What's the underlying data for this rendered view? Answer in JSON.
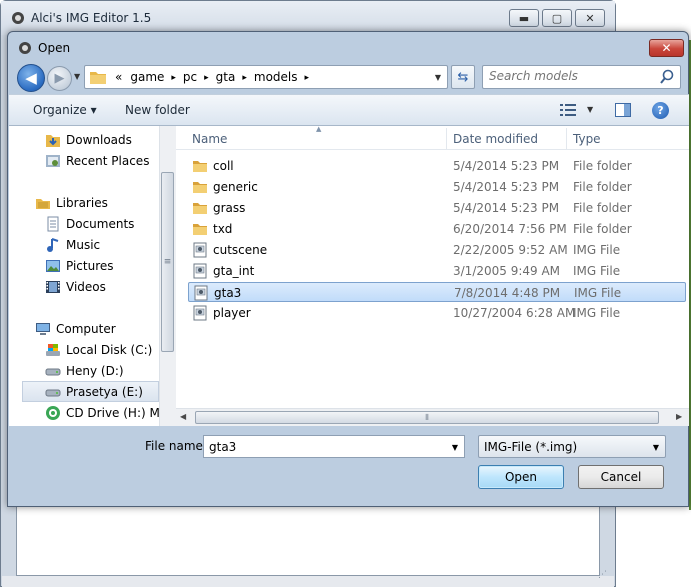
{
  "parent_window": {
    "title": "Alci's IMG Editor 1.5",
    "buttons": {
      "minimize": "▬",
      "maximize": "▢",
      "close": "✕"
    }
  },
  "dialog": {
    "title": "Open",
    "close": "✕"
  },
  "address": {
    "prefix": "«",
    "crumbs": [
      "game",
      "pc",
      "gta",
      "models"
    ],
    "crumb_sep": "▸"
  },
  "search": {
    "placeholder": "Search models"
  },
  "toolbar": {
    "organize": "Organize ▾",
    "new_folder": "New folder",
    "help": "?"
  },
  "nav": {
    "favorites": [
      {
        "label": "Downloads"
      },
      {
        "label": "Recent Places"
      }
    ],
    "libraries_label": "Libraries",
    "libraries": [
      {
        "label": "Documents"
      },
      {
        "label": "Music"
      },
      {
        "label": "Pictures"
      },
      {
        "label": "Videos"
      }
    ],
    "computer_label": "Computer",
    "drives": [
      {
        "label": "Local Disk (C:)"
      },
      {
        "label": "Heny (D:)"
      },
      {
        "label": "Prasetya (E:)",
        "selected": true
      },
      {
        "label": "CD Drive (H:) Mo"
      }
    ]
  },
  "columns": {
    "name": "Name",
    "date": "Date modified",
    "type": "Type"
  },
  "files": [
    {
      "name": "coll",
      "date": "5/4/2014 5:23 PM",
      "type": "File folder",
      "kind": "folder"
    },
    {
      "name": "generic",
      "date": "5/4/2014 5:23 PM",
      "type": "File folder",
      "kind": "folder"
    },
    {
      "name": "grass",
      "date": "5/4/2014 5:23 PM",
      "type": "File folder",
      "kind": "folder"
    },
    {
      "name": "txd",
      "date": "6/20/2014 7:56 PM",
      "type": "File folder",
      "kind": "folder"
    },
    {
      "name": "cutscene",
      "date": "2/22/2005 9:52 AM",
      "type": "IMG File",
      "kind": "img"
    },
    {
      "name": "gta_int",
      "date": "3/1/2005 9:49 AM",
      "type": "IMG File",
      "kind": "img"
    },
    {
      "name": "gta3",
      "date": "7/8/2014 4:48 PM",
      "type": "IMG File",
      "kind": "img",
      "selected": true
    },
    {
      "name": "player",
      "date": "10/27/2004 6:28 AM",
      "type": "IMG File",
      "kind": "img"
    }
  ],
  "filename": {
    "label": "File name:",
    "value": "gta3"
  },
  "filter": {
    "value": "IMG-File (*.img)"
  },
  "buttons": {
    "open": "Open",
    "cancel": "Cancel"
  },
  "colors": {
    "accent": "#3c7fb1",
    "selection": "#c1dcfa",
    "folder": "#e8b84a",
    "title_bar": "#bccde0"
  }
}
